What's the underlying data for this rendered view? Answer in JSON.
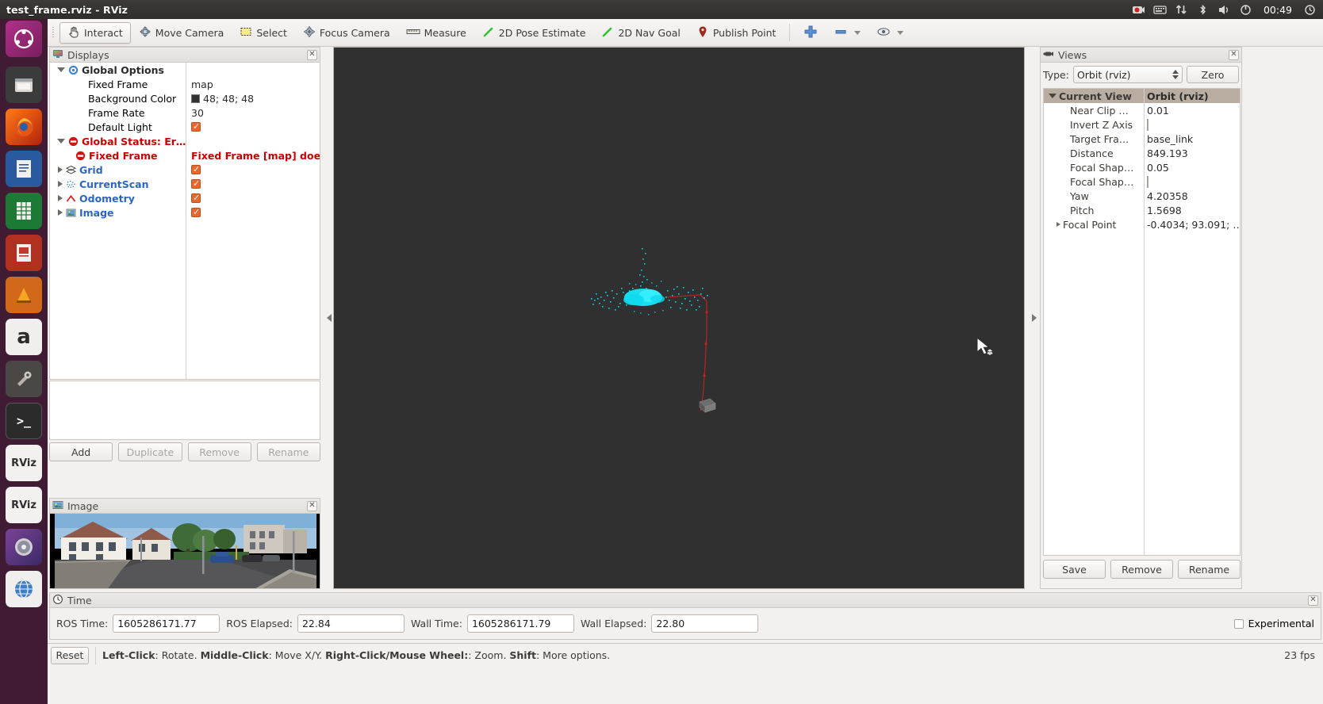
{
  "window": {
    "title": "test_frame.rviz - RViz"
  },
  "systembar": {
    "clock": "00:49",
    "icons": [
      "record-icon",
      "keyboard-layout-icon",
      "network-icon",
      "bluetooth-icon",
      "volume-icon",
      "power-icon"
    ]
  },
  "launcher": {
    "items": [
      {
        "name": "ubuntu-dash-icon",
        "glyph": "◉",
        "color": "#d94c1a"
      },
      {
        "name": "files-icon",
        "glyph": "▤",
        "color": "#e8e6e3"
      },
      {
        "name": "firefox-icon",
        "glyph": "◐",
        "color": "#e55b1f"
      },
      {
        "name": "libreoffice-writer-icon",
        "glyph": "▤",
        "color": "#2a6099"
      },
      {
        "name": "libreoffice-calc-icon",
        "glyph": "▤",
        "color": "#1d8a3a"
      },
      {
        "name": "libreoffice-impress-icon",
        "glyph": "▤",
        "color": "#c8351a"
      },
      {
        "name": "software-center-icon",
        "glyph": "▲",
        "color": "#d35400"
      },
      {
        "name": "amazon-icon",
        "glyph": "a",
        "color": "#f2f1f0"
      },
      {
        "name": "system-settings-icon",
        "glyph": "✶",
        "color": "#b0a8a0"
      },
      {
        "name": "terminal-icon",
        "glyph": ">_",
        "color": "#2b2b2b"
      },
      {
        "name": "rviz-icon-1",
        "glyph": "RViz",
        "color": "#3c3b37"
      },
      {
        "name": "rviz-icon-2",
        "glyph": "RViz",
        "color": "#3c3b37"
      },
      {
        "name": "disc-icon",
        "glyph": "◍",
        "color": "#6a3d8f"
      },
      {
        "name": "help-icon",
        "glyph": "◎",
        "color": "#2a6099"
      }
    ]
  },
  "toolbar": {
    "interact": "Interact",
    "move_camera": "Move Camera",
    "select": "Select",
    "focus_camera": "Focus Camera",
    "measure": "Measure",
    "pose_estimate": "2D Pose Estimate",
    "nav_goal": "2D Nav Goal",
    "publish_point": "Publish Point",
    "icons": [
      "hand-icon",
      "move-camera-icon",
      "select-icon",
      "focus-camera-icon",
      "measure-icon",
      "pose-arrow-icon",
      "nav-arrow-icon",
      "map-pin-icon",
      "add-tool-icon",
      "remove-tool-icon",
      "visibility-icon"
    ]
  },
  "displays": {
    "title": "Displays",
    "rows": [
      {
        "indent": 0,
        "tri": "open",
        "icon": "gear-icon",
        "label": "Global Options",
        "style": "bold-dark",
        "value_type": "none",
        "value": ""
      },
      {
        "indent": 1,
        "tri": "none",
        "icon": "",
        "label": "Fixed Frame",
        "style": "plain",
        "value_type": "text",
        "value": "map"
      },
      {
        "indent": 1,
        "tri": "none",
        "icon": "",
        "label": "Background Color",
        "style": "plain",
        "value_type": "color",
        "value": "48; 48; 48",
        "color": "#303030"
      },
      {
        "indent": 1,
        "tri": "none",
        "icon": "",
        "label": "Frame Rate",
        "style": "plain",
        "value_type": "text",
        "value": "30"
      },
      {
        "indent": 1,
        "tri": "none",
        "icon": "",
        "label": "Default Light",
        "style": "plain",
        "value_type": "check",
        "value": ""
      },
      {
        "indent": 0,
        "tri": "open",
        "icon": "error-icon",
        "label": "Global Status: Er…",
        "style": "red",
        "value_type": "none",
        "value": ""
      },
      {
        "indent": 1,
        "tri": "none",
        "icon": "error-icon",
        "label": "Fixed Frame",
        "style": "red",
        "value_type": "text",
        "value": "Fixed Frame [map] doe…"
      },
      {
        "indent": 0,
        "tri": "closed",
        "icon": "grid-icon",
        "label": "Grid",
        "style": "blue",
        "value_type": "check",
        "value": ""
      },
      {
        "indent": 0,
        "tri": "closed",
        "icon": "scan-icon",
        "label": "CurrentScan",
        "style": "blue",
        "value_type": "check",
        "value": ""
      },
      {
        "indent": 0,
        "tri": "closed",
        "icon": "odometry-icon",
        "label": "Odometry",
        "style": "blue",
        "value_type": "check",
        "value": ""
      },
      {
        "indent": 0,
        "tri": "closed",
        "icon": "image-icon",
        "label": "Image",
        "style": "blue",
        "value_type": "check",
        "value": ""
      }
    ],
    "buttons": {
      "add": "Add",
      "duplicate": "Duplicate",
      "remove": "Remove",
      "rename": "Rename"
    }
  },
  "image_panel": {
    "title": "Image"
  },
  "views": {
    "title": "Views",
    "type_label": "Type:",
    "type_value": "Orbit (rviz)",
    "zero_button": "Zero",
    "header": {
      "name": "Current View",
      "value": "Orbit (rviz)"
    },
    "rows": [
      {
        "label": "Near Clip …",
        "value_type": "text",
        "value": "0.01"
      },
      {
        "label": "Invert Z Axis",
        "value_type": "check",
        "value": ""
      },
      {
        "label": "Target Fra…",
        "value_type": "text",
        "value": "base_link"
      },
      {
        "label": "Distance",
        "value_type": "text",
        "value": "849.193"
      },
      {
        "label": "Focal Shap…",
        "value_type": "text",
        "value": "0.05"
      },
      {
        "label": "Focal Shap…",
        "value_type": "check",
        "value": ""
      },
      {
        "label": "Yaw",
        "value_type": "text",
        "value": "4.20358"
      },
      {
        "label": "Pitch",
        "value_type": "text",
        "value": "1.5698"
      },
      {
        "label": "Focal Point",
        "value_type": "text",
        "value": "-0.4034; 93.091; …",
        "expandable": true
      }
    ],
    "buttons": {
      "save": "Save",
      "remove": "Remove",
      "rename": "Rename"
    }
  },
  "time": {
    "title": "Time",
    "ros_time_label": "ROS Time:",
    "ros_time_value": "1605286171.77",
    "ros_elapsed_label": "ROS Elapsed:",
    "ros_elapsed_value": "22.84",
    "wall_time_label": "Wall Time:",
    "wall_time_value": "1605286171.79",
    "wall_elapsed_label": "Wall Elapsed:",
    "wall_elapsed_value": "22.80",
    "experimental_label": "Experimental"
  },
  "status": {
    "reset": "Reset",
    "hint_parts": [
      {
        "text": "Left-Click",
        "bold": true
      },
      {
        "text": ": Rotate.  ",
        "bold": false
      },
      {
        "text": "Middle-Click",
        "bold": true
      },
      {
        "text": ": Move X/Y.  ",
        "bold": false
      },
      {
        "text": "Right-Click/Mouse Wheel:",
        "bold": true
      },
      {
        "text": ": Zoom.  ",
        "bold": false
      },
      {
        "text": "Shift",
        "bold": true
      },
      {
        "text": ": More options.",
        "bold": false
      }
    ],
    "fps": "23 fps"
  },
  "colors": {
    "viewport_bg": "#303030",
    "scan_cyan": "#00e5ff",
    "odom_red": "#cc2222",
    "panel_bg": "#f2f1f0",
    "header_brown": "#b9ada1"
  }
}
